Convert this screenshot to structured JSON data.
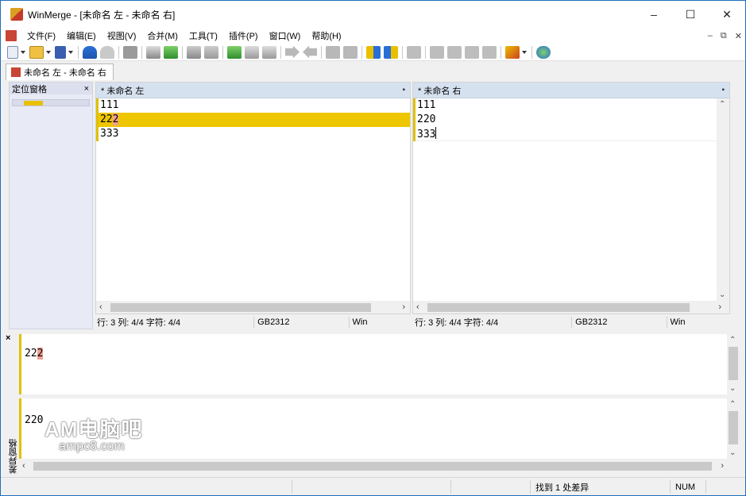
{
  "window": {
    "title": "WinMerge - [未命名 左 - 未命名 右]",
    "minimize": "–",
    "maximize": "☐",
    "close": "✕"
  },
  "menu": {
    "items": [
      {
        "label": "文件(F)"
      },
      {
        "label": "编辑(E)"
      },
      {
        "label": "视图(V)"
      },
      {
        "label": "合并(M)"
      },
      {
        "label": "工具(T)"
      },
      {
        "label": "插件(P)"
      },
      {
        "label": "窗口(W)"
      },
      {
        "label": "帮助(H)"
      }
    ],
    "mdi_min": "–",
    "mdi_restore": "⧉",
    "mdi_close": "✕"
  },
  "doc_tab": {
    "label": "未命名 左 - 未命名 右"
  },
  "location_pane": {
    "title": "定位窗格",
    "close": "×"
  },
  "left_pane": {
    "header": "* 未命名 左",
    "pin": "▪",
    "lines": [
      {
        "text": "111"
      },
      {
        "pre": "22",
        "chg": "2"
      },
      {
        "text": "333"
      }
    ],
    "status": {
      "line": "行: 3",
      "col": "列: 4/4",
      "chr": "字符: 4/4",
      "encoding": "GB2312",
      "eol": "Win"
    }
  },
  "right_pane": {
    "header": "* 未命名 右",
    "pin": "▪",
    "lines": [
      {
        "text": "111"
      },
      {
        "text": "220"
      },
      {
        "text": "333"
      }
    ],
    "status": {
      "line": "行: 3",
      "col": "列: 4/4",
      "chr": "字符: 4/4",
      "encoding": "GB2312",
      "eol": "Win"
    }
  },
  "diff_pane": {
    "close": "×",
    "title": "差异窗格",
    "top": {
      "pre": "22",
      "chg": "2"
    },
    "bottom": {
      "text": "220"
    }
  },
  "watermark": {
    "line1": "AM电脑吧",
    "line2": "ampc8.com"
  },
  "statusbar": {
    "message": "找到 1 处差异",
    "num": "NUM"
  },
  "colors": {
    "diff_highlight": "#eec600",
    "char_change": "#f0a090",
    "pane_header": "#d6e1ef"
  }
}
